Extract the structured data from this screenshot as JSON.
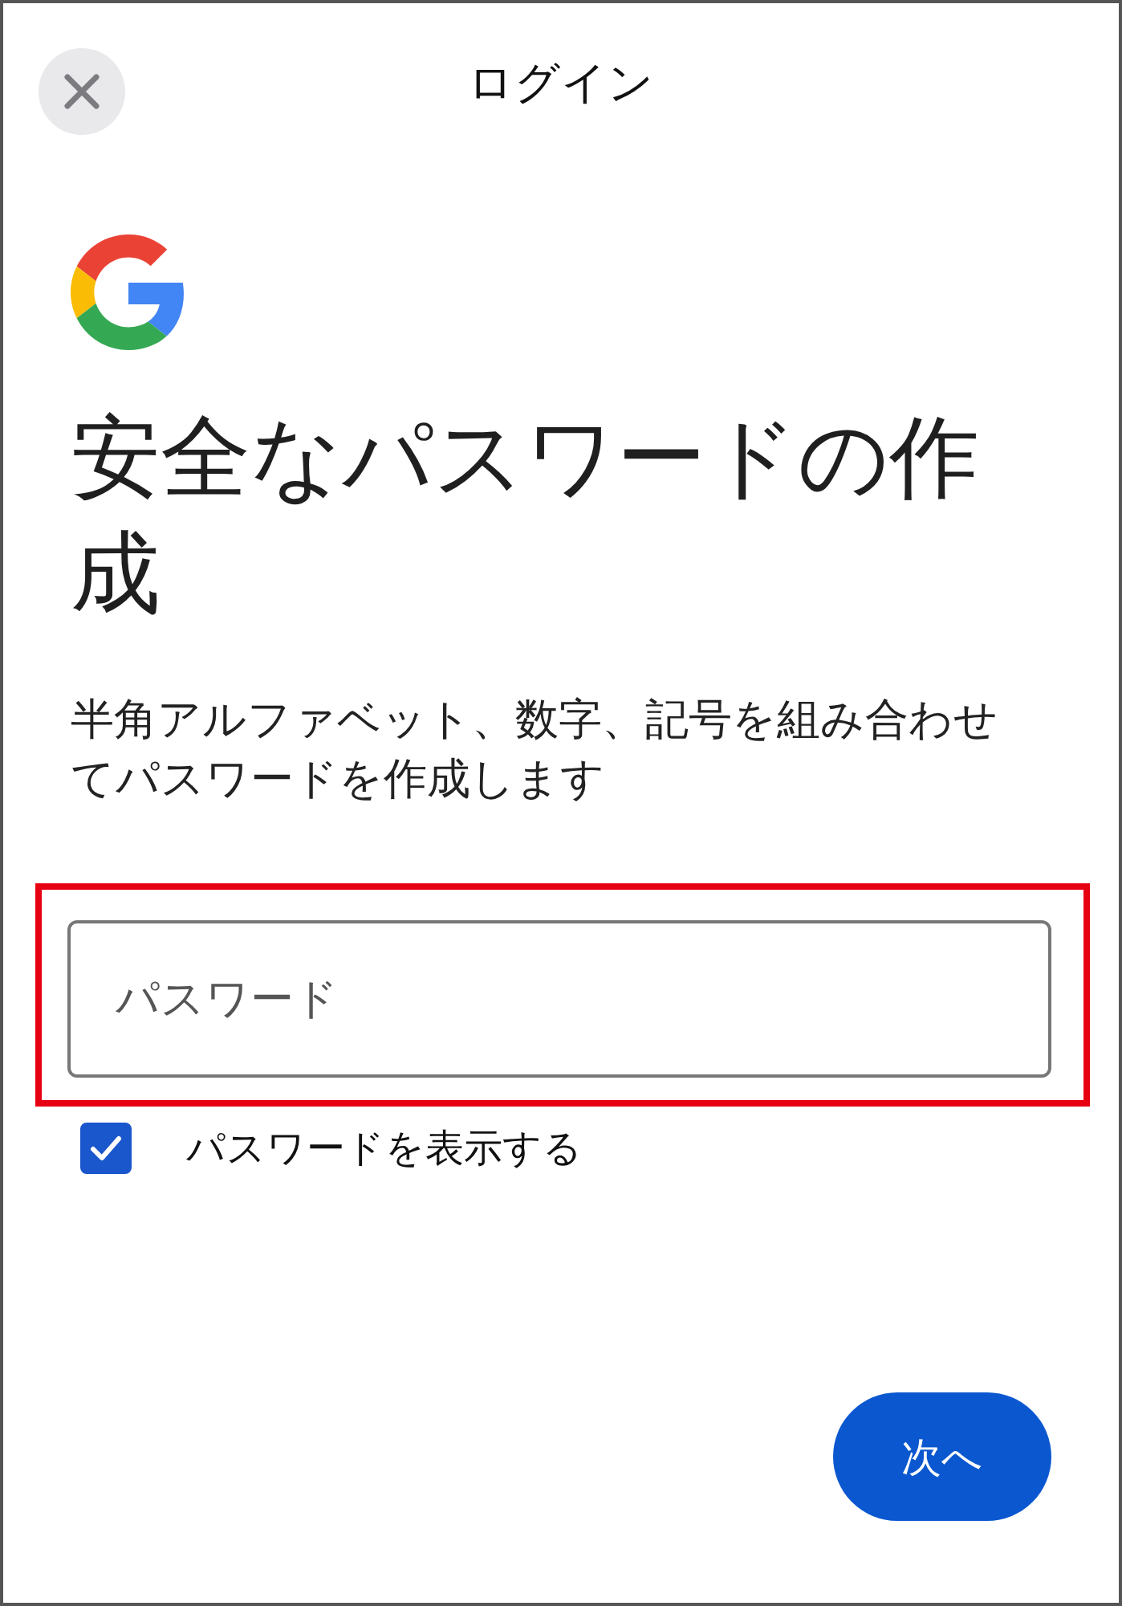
{
  "header": {
    "title": "ログイン"
  },
  "heading": "安全なパスワードの作成",
  "description": "半角アルファベット、数字、記号を組み合わせてパスワードを作成します",
  "password_field": {
    "placeholder": "パスワード",
    "highlighted": true
  },
  "show_password": {
    "label": "パスワードを表示する",
    "checked": true
  },
  "next_button": {
    "label": "次へ"
  }
}
